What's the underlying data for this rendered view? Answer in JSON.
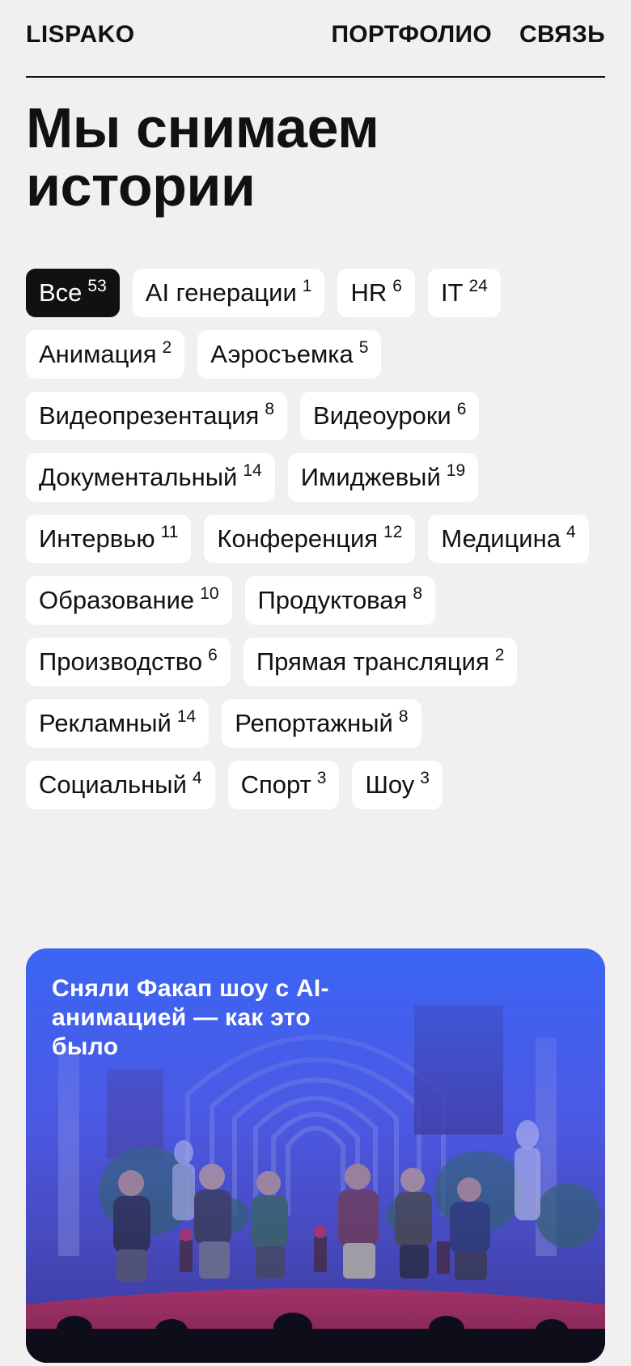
{
  "header": {
    "logo": "LISPAKO",
    "nav": [
      "ПОРТФОЛИО",
      "СВЯЗЬ"
    ]
  },
  "hero": {
    "title": "Мы снимаем истории"
  },
  "filters": [
    {
      "label": "Все",
      "count": "53",
      "active": true
    },
    {
      "label": "AI генерации",
      "count": "1"
    },
    {
      "label": "HR",
      "count": "6"
    },
    {
      "label": "IT",
      "count": "24"
    },
    {
      "label": "Анимация",
      "count": "2"
    },
    {
      "label": "Аэросъемка",
      "count": "5"
    },
    {
      "label": "Видеопрезентация",
      "count": "8"
    },
    {
      "label": "Видеоуроки",
      "count": "6"
    },
    {
      "label": "Документальный",
      "count": "14"
    },
    {
      "label": "Имиджевый",
      "count": "19"
    },
    {
      "label": "Интервью",
      "count": "11"
    },
    {
      "label": "Конференция",
      "count": "12"
    },
    {
      "label": "Медицина",
      "count": "4"
    },
    {
      "label": "Образование",
      "count": "10"
    },
    {
      "label": "Продуктовая",
      "count": "8"
    },
    {
      "label": "Производство",
      "count": "6"
    },
    {
      "label": "Прямая трансляция",
      "count": "2"
    },
    {
      "label": "Рекламный",
      "count": "14"
    },
    {
      "label": "Репортажный",
      "count": "8"
    },
    {
      "label": "Социальный",
      "count": "4"
    },
    {
      "label": "Спорт",
      "count": "3"
    },
    {
      "label": "Шоу",
      "count": "3"
    }
  ],
  "featured": {
    "title": "Сняли Факап шоу с AI-анимацией — как это было"
  },
  "colors": {
    "background": "#f0f0f0",
    "text": "#111111",
    "tag_bg": "#ffffff",
    "tag_active_bg": "#111111",
    "card_overlay": "#3b62f2",
    "stage_red": "#d8324e"
  }
}
